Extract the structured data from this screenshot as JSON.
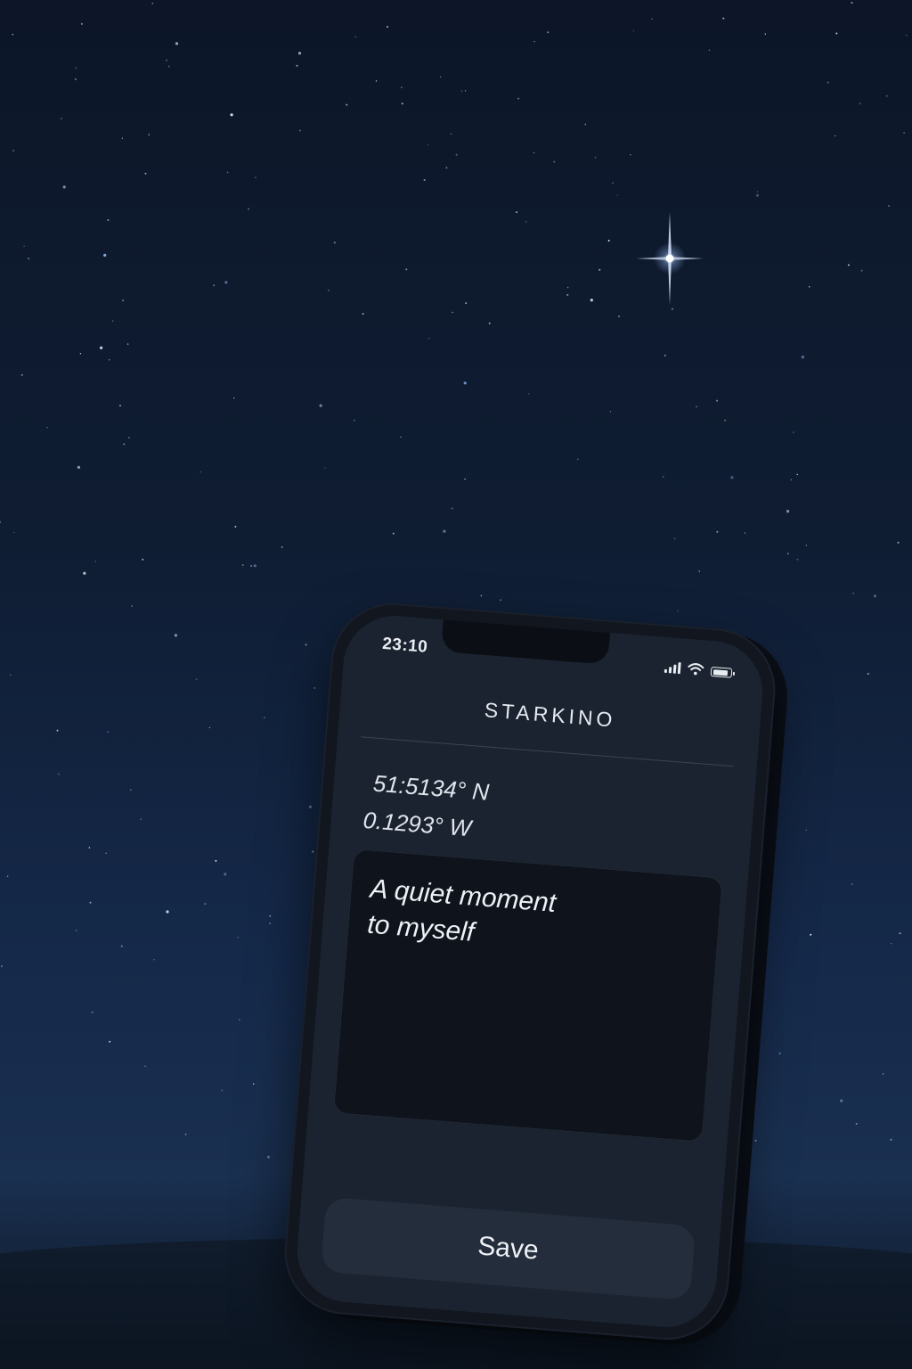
{
  "status_bar": {
    "time": "23:10",
    "icons": [
      "signal-icon",
      "wifi-icon",
      "battery-icon"
    ],
    "battery_level": 0.9
  },
  "app": {
    "title": "STARKINO"
  },
  "location": {
    "latitude": "51:5134° N",
    "longitude": "0.1293° W"
  },
  "note": {
    "text": "A quiet moment\nto myself"
  },
  "actions": {
    "save_label": "Save"
  },
  "colors": {
    "sky": "#0f1d33",
    "screen": "#1b2330",
    "card": "#0f141c",
    "button": "#242d3b",
    "text": "#eef1f6"
  }
}
